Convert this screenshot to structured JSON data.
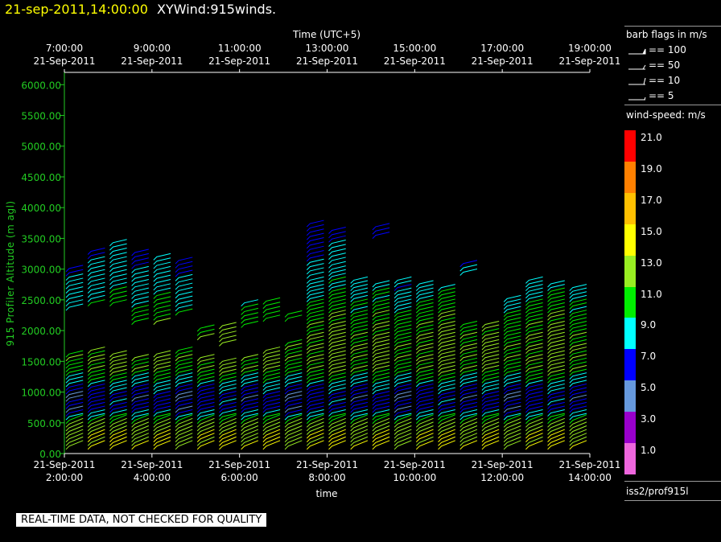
{
  "header": {
    "timestamp": "21-sep-2011,14:00:00",
    "title": "XYWind:915winds."
  },
  "notice": "REAL-TIME DATA, NOT CHECKED FOR QUALITY",
  "colors": {
    "axis_green": "#22cc22",
    "background": "#000000",
    "header_yellow": "#ffff00"
  },
  "legend": {
    "barb_title": "barb flags in m/s",
    "barbs": [
      {
        "kind": "100",
        "label": "== 100"
      },
      {
        "kind": "50",
        "label": "== 50"
      },
      {
        "kind": "10",
        "label": "== 10"
      },
      {
        "kind": "5",
        "label": "== 5"
      }
    ],
    "speed_title": "wind-speed: m/s",
    "scale": [
      {
        "label": "21.0",
        "color": "#ff0000"
      },
      {
        "label": "19.0",
        "color": "#ff8000"
      },
      {
        "label": "17.0",
        "color": "#ffc000"
      },
      {
        "label": "15.0",
        "color": "#ffff00"
      },
      {
        "label": "13.0",
        "color": "#99ee22"
      },
      {
        "label": "11.0",
        "color": "#00ee00"
      },
      {
        "label": "9.0",
        "color": "#00ffff"
      },
      {
        "label": "7.0",
        "color": "#0000ff"
      },
      {
        "label": "5.0",
        "color": "#6699dd"
      },
      {
        "label": "3.0",
        "color": "#9900cc"
      },
      {
        "label": "1.0",
        "color": "#ee66dd"
      }
    ],
    "source": "iss2/prof915l"
  },
  "chart_data": {
    "type": "scatter",
    "ylabel": "915 Profiler Altitude (m agl)",
    "xlabel": "time",
    "top_axis_label": "Time (UTC+5)",
    "ylim": [
      0,
      6200
    ],
    "yticks": [
      "0.00",
      "500.00",
      "1000.00",
      "1500.00",
      "2000.00",
      "2500.00",
      "3000.00",
      "3500.00",
      "4000.00",
      "4500.00",
      "5000.00",
      "5500.00",
      "6000.00"
    ],
    "bottom_ticks": [
      {
        "hour": 2,
        "date": "21-Sep-2011",
        "time": "2:00:00"
      },
      {
        "hour": 4,
        "date": "21-Sep-2011",
        "time": "4:00:00"
      },
      {
        "hour": 6,
        "date": "21-Sep-2011",
        "time": "6:00:00"
      },
      {
        "hour": 8,
        "date": "21-Sep-2011",
        "time": "8:00:00"
      },
      {
        "hour": 10,
        "date": "21-Sep-2011",
        "time": "10:00:00"
      },
      {
        "hour": 12,
        "date": "21-Sep-2011",
        "time": "12:00:00"
      },
      {
        "hour": 14,
        "date": "21-Sep-2011",
        "time": "14:00:00"
      }
    ],
    "top_ticks": [
      {
        "hour": 2,
        "time": "7:00:00",
        "date": "21-Sep-2011"
      },
      {
        "hour": 4,
        "time": "9:00:00",
        "date": "21-Sep-2011"
      },
      {
        "hour": 6,
        "time": "11:00:00",
        "date": "21-Sep-2011"
      },
      {
        "hour": 8,
        "time": "13:00:00",
        "date": "21-Sep-2011"
      },
      {
        "hour": 10,
        "time": "15:00:00",
        "date": "21-Sep-2011"
      },
      {
        "hour": 12,
        "time": "17:00:00",
        "date": "21-Sep-2011"
      },
      {
        "hour": 14,
        "time": "19:00:00",
        "date": "21-Sep-2011"
      }
    ],
    "xlim_hours": [
      2,
      14
    ],
    "profile_interval_hours": 0.5,
    "profiles": [
      {
        "hour": 2.0,
        "low_max": 1650,
        "upper": [
          2380,
          3050
        ]
      },
      {
        "hour": 2.5,
        "low_max": 1680,
        "upper": [
          2450,
          3300
        ]
      },
      {
        "hour": 3.0,
        "low_max": 1620,
        "upper": [
          2450,
          3450
        ]
      },
      {
        "hour": 3.5,
        "low_max": 1600,
        "upper": [
          2150,
          3300
        ]
      },
      {
        "hour": 4.0,
        "low_max": 1650,
        "upper": [
          2150,
          3250
        ]
      },
      {
        "hour": 4.5,
        "low_max": 1700,
        "upper": [
          2300,
          3200
        ]
      },
      {
        "hour": 5.0,
        "low_max": 1600,
        "upper": [
          1900,
          2100
        ]
      },
      {
        "hour": 5.5,
        "low_max": 1550,
        "upper": [
          1800,
          2100
        ]
      },
      {
        "hour": 6.0,
        "low_max": 1600,
        "upper": [
          2100,
          2500
        ]
      },
      {
        "hour": 6.5,
        "low_max": 1700,
        "upper": [
          2200,
          2500
        ]
      },
      {
        "hour": 7.0,
        "low_max": 1800,
        "upper": [
          2200,
          2300
        ]
      },
      {
        "hour": 7.5,
        "low_max": 2850,
        "upper": [
          2900,
          3800
        ]
      },
      {
        "hour": 8.0,
        "low_max": 2950,
        "upper": [
          3000,
          3650
        ]
      },
      {
        "hour": 8.5,
        "low_max": 2850,
        "upper": []
      },
      {
        "hour": 9.0,
        "low_max": 2800,
        "upper": [
          3550,
          3750
        ]
      },
      {
        "hour": 9.5,
        "low_max": 2850,
        "upper": []
      },
      {
        "hour": 10.0,
        "low_max": 2800,
        "upper": []
      },
      {
        "hour": 10.5,
        "low_max": 2700,
        "upper": []
      },
      {
        "hour": 11.0,
        "low_max": 2100,
        "upper": [
          2950,
          3100
        ]
      },
      {
        "hour": 11.5,
        "low_max": 2100,
        "upper": []
      },
      {
        "hour": 12.0,
        "low_max": 2550,
        "upper": []
      },
      {
        "hour": 12.5,
        "low_max": 2850,
        "upper": []
      },
      {
        "hour": 13.0,
        "low_max": 2800,
        "upper": []
      },
      {
        "hour": 13.5,
        "low_max": 2700,
        "upper": []
      }
    ],
    "speed_by_altitude": [
      {
        "alt": 0,
        "speed": 14.5
      },
      {
        "alt": 250,
        "speed": 14.0
      },
      {
        "alt": 500,
        "speed": 12.5
      },
      {
        "alt": 700,
        "speed": 7.0
      },
      {
        "alt": 950,
        "speed": 6.5
      },
      {
        "alt": 1150,
        "speed": 9.0
      },
      {
        "alt": 1350,
        "speed": 12.0
      },
      {
        "alt": 1700,
        "speed": 12.5
      },
      {
        "alt": 2200,
        "speed": 11.5
      },
      {
        "alt": 2600,
        "speed": 9.5
      },
      {
        "alt": 3000,
        "speed": 8.5
      },
      {
        "alt": 3500,
        "speed": 7.0
      }
    ]
  }
}
